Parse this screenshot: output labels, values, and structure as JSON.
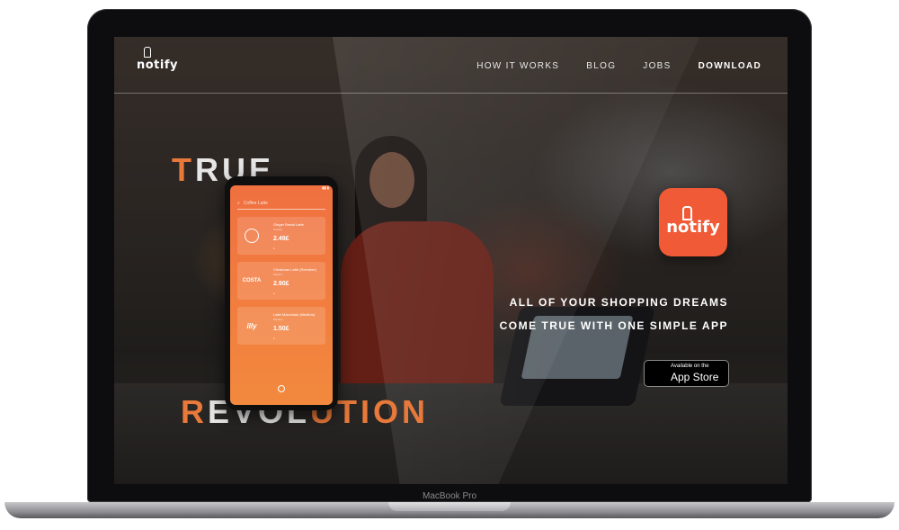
{
  "device": {
    "label": "MacBook Pro"
  },
  "nav": {
    "logo_text": "notify",
    "links": [
      {
        "label": "HOW IT WORKS"
      },
      {
        "label": "BLOG"
      },
      {
        "label": "JOBS"
      },
      {
        "label": "DOWNLOAD"
      }
    ]
  },
  "hero": {
    "headline_top": {
      "accent": "T",
      "rest": "RUE"
    },
    "headline_bottom": {
      "accent1": "R",
      "mid1": "EVOL",
      "accent2": "U",
      "accent3": "TION"
    },
    "tagline_line1": "ALL OF YOUR SHOPPING DREAMS",
    "tagline_line2": "COME TRUE WITH ONE SIMPLE APP",
    "app_icon_text": "notify",
    "appstore": {
      "small": "Available on the",
      "big": "App Store"
    }
  },
  "phone": {
    "search_placeholder": "Coffee Latte",
    "items": [
      {
        "brand": "STARBUCKS",
        "name": "Ginger Bread Latte",
        "sub": "Grande",
        "price": "2.49£",
        "qty": "1"
      },
      {
        "brand": "COSTA",
        "name": "Christmas Latte (Reindeer)",
        "sub": "Medium",
        "price": "2.90£",
        "qty": "1"
      },
      {
        "brand": "illy",
        "name": "Latte Macchiato (Medium)",
        "sub": "Medium",
        "price": "1.50£",
        "qty": "1"
      }
    ]
  },
  "colors": {
    "accent": "#e8793a",
    "brand_orange": "#f05a36"
  }
}
